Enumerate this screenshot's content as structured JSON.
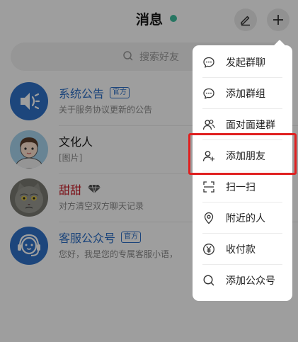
{
  "header": {
    "title": "消息",
    "edit_icon": "edit-icon",
    "add_icon": "plus-icon"
  },
  "search": {
    "placeholder": "搜索好友"
  },
  "chats": [
    {
      "name": "系统公告",
      "badge": "官方",
      "preview": "关于服务协议更新的公告",
      "avatar": "speaker-icon"
    },
    {
      "name": "文化人",
      "badge": "",
      "preview": "[图片]",
      "avatar": "cartoon-boy-avatar"
    },
    {
      "name": "甜甜",
      "badge": "",
      "preview": "对方清空双方聊天记录",
      "avatar": "cat-avatar",
      "vip_icon": "diamond-icon"
    },
    {
      "name": "客服公众号",
      "badge": "官方",
      "preview": "您好，我是您的专属客服小语，",
      "avatar": "headset-icon"
    }
  ],
  "menu": {
    "items": [
      {
        "label": "发起群聊",
        "icon": "chat-bubble-icon"
      },
      {
        "label": "添加群组",
        "icon": "chat-bubble-icon"
      },
      {
        "label": "面对面建群",
        "icon": "group-icon"
      },
      {
        "label": "添加朋友",
        "icon": "add-user-icon"
      },
      {
        "label": "扫一扫",
        "icon": "scan-icon"
      },
      {
        "label": "附近的人",
        "icon": "location-pin-icon"
      },
      {
        "label": "收付款",
        "icon": "yen-icon"
      },
      {
        "label": "添加公众号",
        "icon": "search-icon"
      }
    ],
    "highlighted_index": 3
  },
  "colors": {
    "accent_blue": "#2c6fc7",
    "status_green": "#3fbf9f",
    "name_red": "#c8202b",
    "highlight_red": "#e02020"
  }
}
